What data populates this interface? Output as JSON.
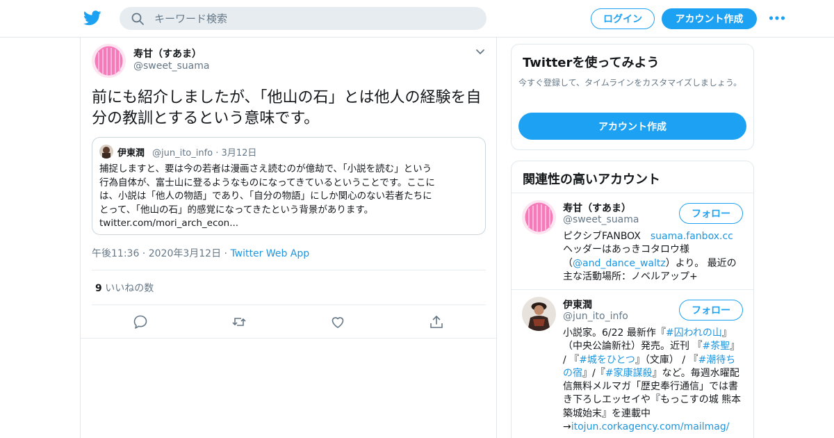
{
  "header": {
    "search_placeholder": "キーワード検索",
    "login_label": "ログイン",
    "signup_label": "アカウント作成"
  },
  "tweet": {
    "name": "寿甘（すあま）",
    "handle": "@sweet_suama",
    "text": "前にも紹介しましたが、「他山の石」とは他人の経験を自分の教訓とするという意味です。",
    "quote": {
      "name": "伊東潤",
      "handle": "@jun_ito_info",
      "date": "3月12日",
      "text_lines": [
        "捕捉しますと、要は今の若者は漫画さえ読むのが億劫で、「小説を読む」という",
        "行為自体が、富士山に登るようなものになってきているということです。ここに",
        "は、小説は「他人の物語」であり、「自分の物語」にしか関心のない若者たちに",
        "とって、「他山の石」的感覚になってきたという背景があります。",
        "twitter.com/mori_arch_econ..."
      ]
    },
    "time": "午後11:36",
    "date": "2020年3月12日",
    "app": "Twitter Web App",
    "likes_count": "9",
    "likes_label": "いいねの数"
  },
  "promo": {
    "title": "Twitterを使ってみよう",
    "description": "今すぐ登録して、タイムラインをカスタマイズしましょう。",
    "button_label": "アカウント作成"
  },
  "related": {
    "title": "関連性の高いアカウント",
    "follow_label": "フォロー",
    "accounts": [
      {
        "name": "寿甘（すあま）",
        "handle": "@sweet_suama",
        "bio_1": "ピクシブFANBOX　",
        "bio_link_1": "suama.fanbox.cc",
        "bio_2": "ヘッダーはあっきコタロウ様（",
        "bio_link_2": "@and_dance_waltz",
        "bio_3": "）より。 最近の主な活動場所：ノベルアップ+"
      },
      {
        "name": "伊東潤",
        "handle": "@jun_ito_info",
        "bio_1": "小説家。6/22 最新作『",
        "bio_link_1": "#囚われの山",
        "bio_2": "』（中央公論新社）発売。近刊 『",
        "bio_link_2": "#茶聖",
        "bio_3": "』 / 『",
        "bio_link_3": "#城をひとつ",
        "bio_4": "』（文庫） / 『",
        "bio_link_4": "#潮待ちの宿",
        "bio_5": "』/『",
        "bio_link_5": "#家康謀殺",
        "bio_6": "』など。毎週水曜配信無料メルマガ「歴史奉行通信」では書き下ろしエッセイや『もっこすの城 熊本築城始末』を連載中→",
        "bio_link_6": "itojun.corkagency.com/mailmag/"
      }
    ]
  },
  "colors": {
    "brand": "#1da1f2",
    "link": "#1b95e0",
    "secondary_text": "#657786",
    "border": "#e1e8ed"
  },
  "icons": [
    "twitter-bird-icon",
    "search-icon",
    "more-dots-icon",
    "chevron-down-icon",
    "reply-icon",
    "retweet-icon",
    "like-icon",
    "share-icon"
  ]
}
